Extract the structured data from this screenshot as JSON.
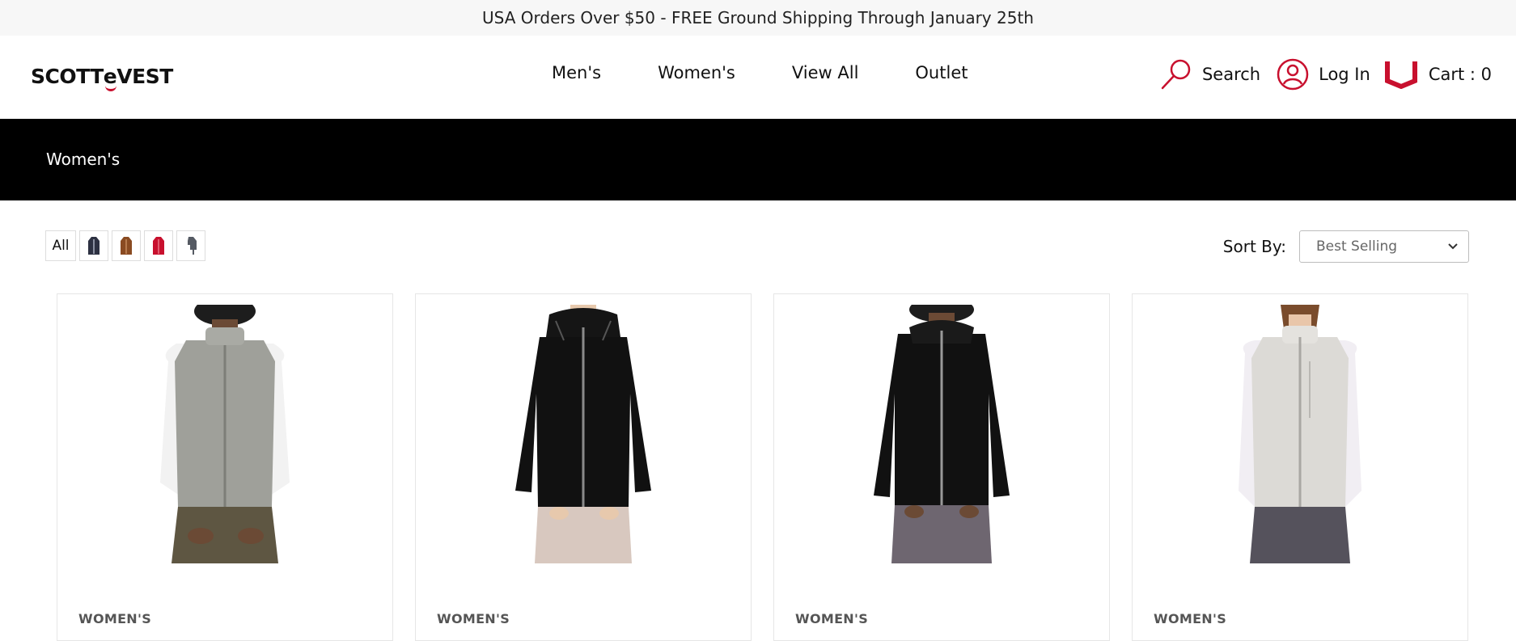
{
  "promo": {
    "text": "USA Orders Over $50 - FREE Ground Shipping Through January 25th"
  },
  "header": {
    "logo": {
      "part1": "SCOTT",
      "part2": "e",
      "part3": "VEST"
    },
    "nav": [
      "Men's",
      "Women's",
      "View All",
      "Outlet"
    ],
    "search_label": "Search",
    "login_label": "Log In",
    "cart_label": "Cart : 0",
    "icons": {
      "search": "search-icon",
      "account": "user-icon",
      "cart": "cart-icon"
    },
    "accent_color": "#c8102e"
  },
  "banner": {
    "title": "Women's",
    "background": "#000000"
  },
  "filters": {
    "all_label": "All",
    "swatches": [
      {
        "name": "navy",
        "color": "#2d3142"
      },
      {
        "name": "brown",
        "color": "#8a4b22"
      },
      {
        "name": "red",
        "color": "#c8102e"
      },
      {
        "name": "gray",
        "color": "#555a63"
      }
    ]
  },
  "sort": {
    "label": "Sort By:",
    "selected": "Best Selling"
  },
  "products": [
    {
      "category": "WOMEN'S",
      "garment_color": "#9fa09a",
      "style": "vest"
    },
    {
      "category": "WOMEN'S",
      "garment_color": "#111111",
      "style": "hoodie"
    },
    {
      "category": "WOMEN'S",
      "garment_color": "#111111",
      "style": "hoodie"
    },
    {
      "category": "WOMEN'S",
      "garment_color": "#dcdad6",
      "style": "vest"
    }
  ]
}
